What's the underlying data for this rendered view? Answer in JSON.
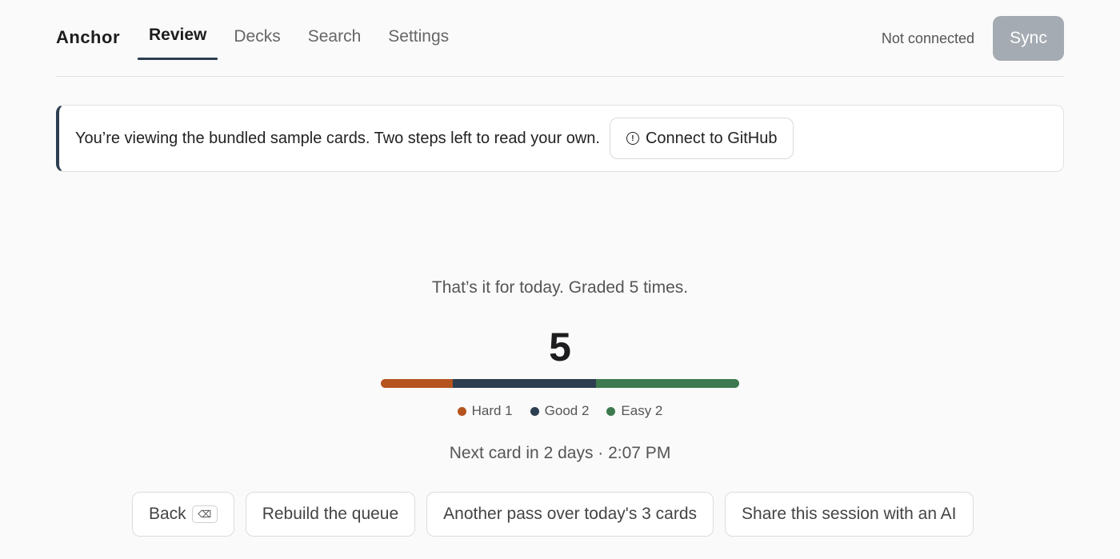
{
  "header": {
    "brand": "Anchor",
    "tabs": [
      {
        "label": "Review",
        "active": true
      },
      {
        "label": "Decks",
        "active": false
      },
      {
        "label": "Search",
        "active": false
      },
      {
        "label": "Settings",
        "active": false
      }
    ],
    "status": "Not connected",
    "sync_label": "Sync"
  },
  "notice": {
    "text": "You’re viewing the bundled sample cards. Two steps left to read your own.",
    "icon": "info-icon",
    "icon_glyph": "!",
    "button_label": "Connect to GitHub"
  },
  "summary": {
    "message": "That’s it for today. Graded 5 times.",
    "count": "5",
    "grades": [
      {
        "label": "Hard 1",
        "value": 1,
        "color": "#b5541e"
      },
      {
        "label": "Good 2",
        "value": 2,
        "color": "#2c3e50"
      },
      {
        "label": "Easy 2",
        "value": 2,
        "color": "#3d7a4f"
      }
    ],
    "next": "Next card in 2 days · 2:07 PM"
  },
  "actions": {
    "back_label": "Back",
    "back_key": "⌫",
    "rebuild_label": "Rebuild the queue",
    "another_pass_label": "Another pass over today's 3 cards",
    "share_label": "Share this session with an AI"
  }
}
